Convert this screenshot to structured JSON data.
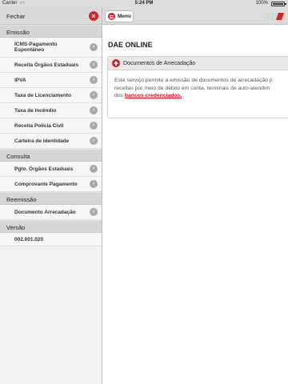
{
  "status_bar": {
    "carrier": "Carrier",
    "time": "5:24 PM",
    "battery": "100%"
  },
  "sidebar": {
    "close_label": "Fechar",
    "close_icon": "close-icon",
    "sections": [
      {
        "title": "Emissão",
        "items": [
          "ICMS-Pagamento Espontâneo",
          "Receita Órgãos Estaduais",
          "IPVA",
          "Taxa de Licenciamento",
          "Taxa de Incêndio",
          "Receita Polícia Civil",
          "Carteira de Identidade"
        ]
      },
      {
        "title": "Consulta",
        "items": [
          "Pgto. Órgãos Estaduais",
          "Comprovante Pagamento"
        ]
      },
      {
        "title": "Reemissão",
        "items": [
          "Documento Arrecadação"
        ]
      },
      {
        "title": "Versão",
        "items": []
      }
    ],
    "version_value": "002.001.020"
  },
  "topbar": {
    "menu_label": "Menu",
    "logo_text": "SEF"
  },
  "main": {
    "title": "DAE ONLINE",
    "panel_title": "Documentos de Arrecadação",
    "body_line1": "Este serviço permite a emissão de documentos de arrecadação p",
    "body_line2": "receitas por meio de débito em conta, terminais de auto-atendim",
    "body_prefix": "dos ",
    "body_link": "bancos credenciados."
  },
  "colors": {
    "accent": "#d1232a",
    "sidebar_bg": "#f2f2f2",
    "header_bg": "#d6d6d6"
  }
}
